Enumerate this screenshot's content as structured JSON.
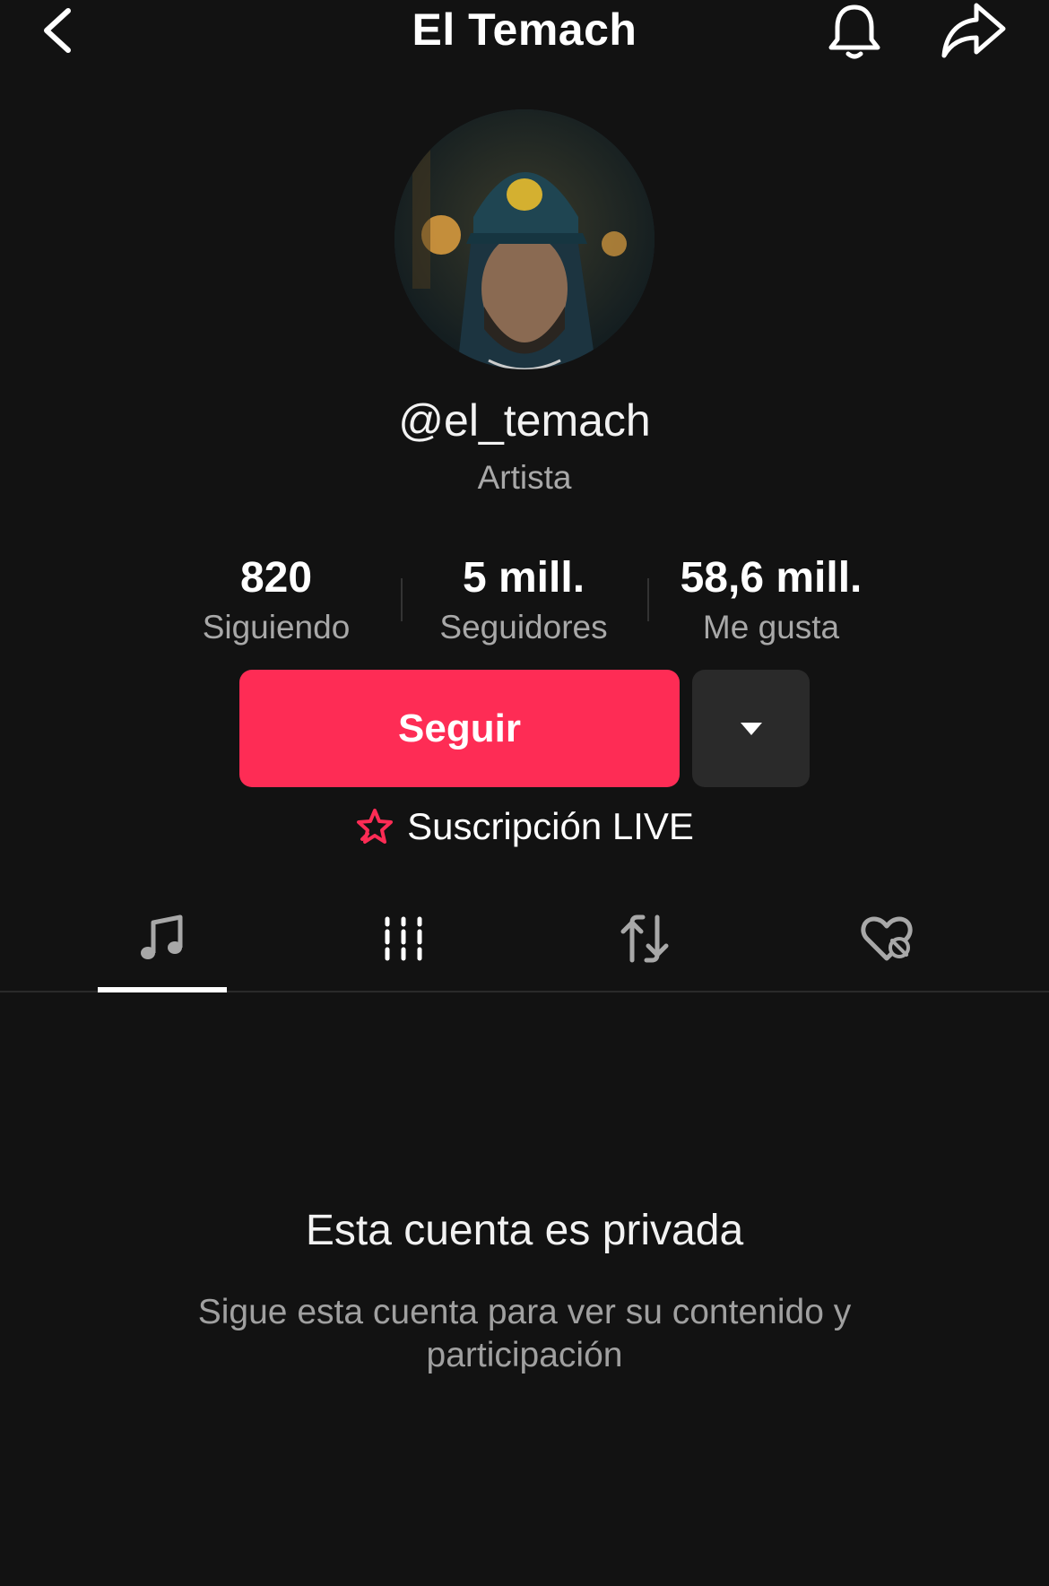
{
  "header": {
    "title": "El Temach",
    "back_icon": "chevron-left-icon",
    "bell_icon": "bell-icon",
    "share_icon": "share-arrow-icon"
  },
  "profile": {
    "avatar_icon": "profile-avatar",
    "username": "@el_temach",
    "category": "Artista"
  },
  "stats": [
    {
      "value": "820",
      "label": "Siguiendo"
    },
    {
      "value": "5 mill.",
      "label": "Seguidores"
    },
    {
      "value": "58,6 mill.",
      "label": "Me gusta"
    }
  ],
  "actions": {
    "follow_label": "Seguir",
    "more_icon": "caret-down-icon",
    "live_subscription_label": "Suscripción LIVE",
    "live_icon": "star-badge-icon"
  },
  "tabs": [
    {
      "icon": "music-note-icon",
      "active": true
    },
    {
      "icon": "grid-columns-icon",
      "active": false
    },
    {
      "icon": "repost-icon",
      "active": false
    },
    {
      "icon": "heart-hidden-icon",
      "active": false
    }
  ],
  "private_notice": {
    "title": "Esta cuenta es privada",
    "message": "Sigue esta cuenta para ver su contenido y participación"
  },
  "colors": {
    "background": "#121212",
    "accent": "#fe2c55",
    "secondary_text": "#a8a8a8",
    "button_dark": "#2a2a2a"
  }
}
